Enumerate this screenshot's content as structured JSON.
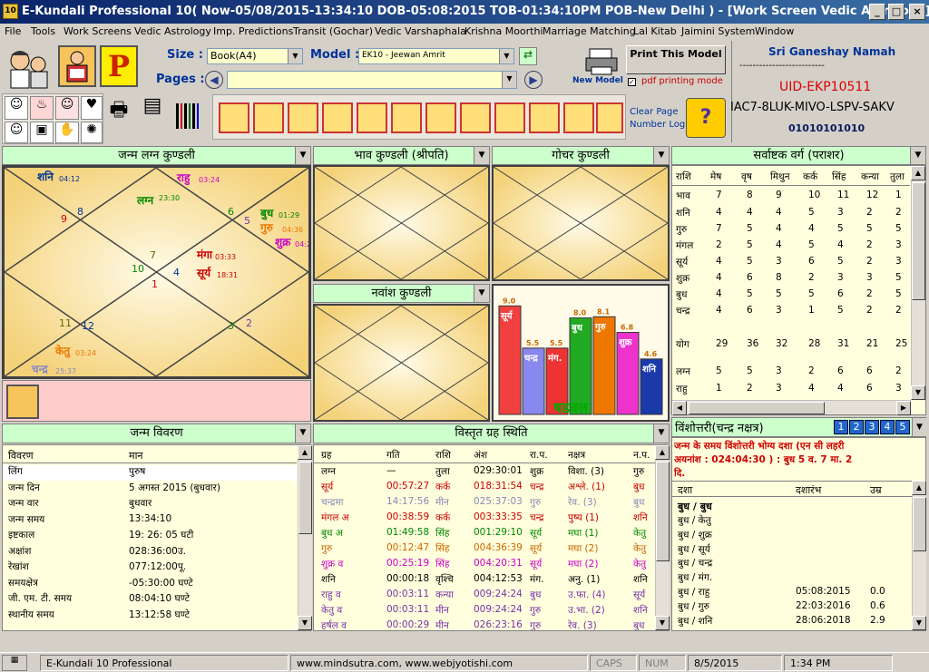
{
  "window": {
    "title": "E-Kundali Professional 10( Now-05/08/2015-13:34:10 DOB-05:08:2015 TOB-01:34:10PM POB-New Delhi ) - [Work Screen Vedic Astrology]",
    "app_icon_text": "10",
    "min": "_",
    "max": "□",
    "close": "×"
  },
  "menu": [
    "File",
    "Tools",
    "Work Screens",
    "Vedic Astrology",
    "Imp. Predictions",
    "Transit (Gochar)",
    "Vedic Varshaphala",
    "Krishna Moorthi",
    "Marriage Matching",
    "Lal Kitab",
    "Jaimini System",
    "Window"
  ],
  "toolbar": {
    "size_label": "Size :",
    "size_value": "Book(A4)",
    "model_label": "Model :",
    "model_value": "EK10 - Jeewan Amrit",
    "pages_label": "Pages :",
    "pages_value": "",
    "new_model": "New Model",
    "print_btn": "Print This Model",
    "pdf_label": "pdf printing mode",
    "clear_page": "Clear Page",
    "number_log": "Number Log",
    "p_icon": "P"
  },
  "license": {
    "greeting": "Sri Ganeshay Namah",
    "dashes": "--------------------------",
    "uid": "UID-EKP10511",
    "serial": "IAC7-8LUK-MIVO-LSPV-SAKV",
    "code": "01010101010"
  },
  "charts": {
    "lagna": {
      "title": "जन्म लग्न कुण्डली",
      "houses": [
        "1",
        "2",
        "3",
        "4",
        "5",
        "6",
        "7",
        "8",
        "9",
        "10",
        "11",
        "12"
      ],
      "planets": {
        "shani": "शनि",
        "shani_deg": "04:12",
        "rahu": "राहु",
        "rahu_deg": "03:24",
        "lagna": "लग्न",
        "lagna_deg": "23:30",
        "budh": "बुध",
        "budh_deg": "01:29",
        "guru": "गुरु",
        "guru_deg": "04:36",
        "shukra": "शुक्र",
        "shukra_deg": "04:2",
        "mangal": "मंगा",
        "mangal_deg": "03:33",
        "surya": "सूर्य",
        "surya_deg": "18:31",
        "ketu": "केतु",
        "ketu_deg": "03:24",
        "chandra": "चन्द्र",
        "chandra_deg": "25:37"
      }
    },
    "bhava": {
      "title": "भाव कुण्डली (श्रीपति)"
    },
    "gochar": {
      "title": "गोचर कुण्डली"
    },
    "navansh": {
      "title": "नवांश कुण्डली"
    },
    "shadbal": {
      "title": "षडबल",
      "values": [
        9.0,
        5.5,
        5.5,
        8.0,
        8.1,
        6.8,
        4.6
      ],
      "labels": [
        "सूर्य",
        "चन्द्र",
        "मंग.",
        "बुध",
        "गुरु",
        "शुक्र",
        "शनि"
      ],
      "value_labels": [
        "9.0",
        "5.5",
        "5.5",
        "8.0",
        "8.1",
        "6.8",
        "4.6"
      ],
      "colors": [
        "#f04040",
        "#8888ee",
        "#ee3333",
        "#22aa22",
        "#ee7700",
        "#ee33cc",
        "#1a3aaa"
      ]
    }
  },
  "ashtak": {
    "title": "सर्वाष्टक वर्ग (पराशर)",
    "headers": [
      "राशि",
      "मेष",
      "वृष",
      "मिथुन",
      "कर्क",
      "सिंह",
      "कन्या",
      "तुला"
    ],
    "rows": [
      [
        "भाव",
        "7",
        "8",
        "9",
        "10",
        "11",
        "12",
        "1"
      ],
      [
        "शनि",
        "4",
        "4",
        "4",
        "5",
        "3",
        "2",
        "2"
      ],
      [
        "गुरु",
        "7",
        "5",
        "4",
        "4",
        "5",
        "5",
        "5"
      ],
      [
        "मंगल",
        "2",
        "5",
        "4",
        "5",
        "4",
        "2",
        "3"
      ],
      [
        "सूर्य",
        "4",
        "5",
        "3",
        "6",
        "5",
        "2",
        "3"
      ],
      [
        "शुक्र",
        "4",
        "6",
        "8",
        "2",
        "3",
        "3",
        "5"
      ],
      [
        "बुध",
        "4",
        "5",
        "5",
        "5",
        "6",
        "2",
        "5"
      ],
      [
        "चन्द्र",
        "4",
        "6",
        "3",
        "1",
        "5",
        "2",
        "2"
      ],
      [
        "योग",
        "29",
        "36",
        "32",
        "28",
        "31",
        "21",
        "25"
      ],
      [
        "लग्न",
        "5",
        "5",
        "3",
        "2",
        "6",
        "6",
        "2"
      ],
      [
        "राहु",
        "1",
        "2",
        "3",
        "4",
        "4",
        "6",
        "3"
      ]
    ]
  },
  "janma": {
    "title": "जन्म विवरण",
    "col1": "विवरण",
    "col2": "मान",
    "rows": [
      [
        "लिंग",
        "पुरुष"
      ],
      [
        "जन्म दिन",
        "5 अगस्त 2015 (बुधवार)"
      ],
      [
        "जन्म वार",
        "बुधवार"
      ],
      [
        "जन्म समय",
        "13:34:10"
      ],
      [
        "इष्टकाल",
        "19: 26: 05 घटी"
      ],
      [
        "अक्षांश",
        "028:36:00उ."
      ],
      [
        "रेखांश",
        "077:12:00पू."
      ],
      [
        "समयक्षेत्र",
        "-05:30:00 घण्टे"
      ],
      [
        "जी. एम. टी. समय",
        "08:04:10 घण्टे"
      ],
      [
        "स्थानीय समय",
        "13:12:58 घण्टे"
      ]
    ]
  },
  "graha": {
    "title": "विस्तृत ग्रह स्थिति",
    "headers": [
      "ग्रह",
      "गति",
      "राशि",
      "अंश",
      "रा.प.",
      "नक्षत्र",
      "न.प."
    ],
    "rows": [
      [
        "लग्न",
        "—",
        "तुला",
        "029:30:01",
        "शुक्र",
        "विशा. (3)",
        "गुरु"
      ],
      [
        "सूर्य",
        "00:57:27",
        "कर्क",
        "018:31:54",
        "चन्द्र",
        "अश्ले. (1)",
        "बुध"
      ],
      [
        "चन्द्रमा",
        "14:17:56",
        "मीन",
        "025:37:03",
        "गुरु",
        "रेव. (3)",
        "बुध"
      ],
      [
        "मंगल अ",
        "00:38:59",
        "कर्क",
        "003:33:35",
        "चन्द्र",
        "पुष्य (1)",
        "शनि"
      ],
      [
        "बुध अ",
        "01:49:58",
        "सिंह",
        "001:29:10",
        "सूर्य",
        "मघा (1)",
        "केतु"
      ],
      [
        "गुरु",
        "00:12:47",
        "सिंह",
        "004:36:39",
        "सूर्य",
        "मघा (2)",
        "केतु"
      ],
      [
        "शुक्र व",
        "00:25:19",
        "सिंह",
        "004:20:31",
        "सूर्य",
        "मघा (2)",
        "केतु"
      ],
      [
        "शनि",
        "00:00:18",
        "वृश्चि",
        "004:12:53",
        "मंग.",
        "अनु. (1)",
        "शनि"
      ],
      [
        "राहु व",
        "00:03:11",
        "कन्या",
        "009:24:24",
        "बुध",
        "उ.फा. (4)",
        "सूर्य"
      ],
      [
        "केतु व",
        "00:03:11",
        "मीन",
        "009:24:24",
        "गुरु",
        "उ.भा. (2)",
        "शनि"
      ],
      [
        "हर्षल व",
        "00:00:29",
        "मीन",
        "026:23:16",
        "गुरु",
        "रेव. (3)",
        "बुध"
      ]
    ],
    "colors": [
      "#000000",
      "#cc0000",
      "#8888bb",
      "#cc0000",
      "#008800",
      "#cc6600",
      "#cc00cc",
      "#000000",
      "#7733aa",
      "#7733aa",
      "#7733aa"
    ]
  },
  "vimshottari": {
    "title": "विंशोत्तरी(चन्द्र नक्षत्र)",
    "tabs": [
      "1",
      "2",
      "3",
      "4",
      "5"
    ],
    "info1": "जन्म के समय विंशोत्तरी भोग्य दशा (एन सी लहरी",
    "info2": "अयनांश : 024:04:30 ) : बुध   5 व. 7 मा. 2",
    "info3": "दि.",
    "headers": [
      "दशा",
      "दशारंभ",
      "उम्र"
    ],
    "group": "बुध / बुध",
    "rows": [
      [
        "बुध / केतु",
        "",
        ""
      ],
      [
        "बुध / शुक्र",
        "",
        ""
      ],
      [
        "बुध / सूर्य",
        "",
        ""
      ],
      [
        "बुध / चन्द्र",
        "",
        ""
      ],
      [
        "बुध / मंग.",
        "",
        ""
      ],
      [
        "बुध / राहु",
        "05:08:2015",
        "0.0"
      ],
      [
        "बुध / गुरु",
        "22:03:2016",
        "0.6"
      ],
      [
        "बुध / शनि",
        "28:06:2018",
        "2.9"
      ]
    ]
  },
  "status": {
    "app": "E-Kundali 10 Professional",
    "web": "www.mindsutra.com, www.webjyotishi.com",
    "caps": "CAPS",
    "num": "NUM",
    "date": "8/5/2015",
    "time": "1:34 PM"
  }
}
